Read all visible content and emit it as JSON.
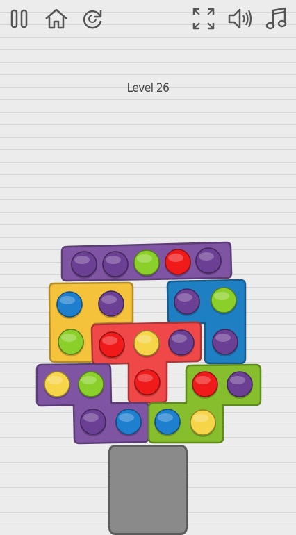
{
  "toolbar": {
    "buttons": [
      {
        "name": "pause-button",
        "icon": "pause-icon"
      },
      {
        "name": "home-button",
        "icon": "home-icon"
      },
      {
        "name": "restart-button",
        "icon": "restart-icon"
      },
      {
        "name": "fullscreen-button",
        "icon": "fullscreen-icon"
      },
      {
        "name": "sound-button",
        "icon": "speaker-icon"
      },
      {
        "name": "music-button",
        "icon": "music-note-icon"
      }
    ]
  },
  "level": {
    "label": "Level 26"
  },
  "colors": {
    "purple": "#7f54a3",
    "yellow": "#f5c33b",
    "blue": "#1f7fc3",
    "red": "#f04848",
    "green": "#86be2d",
    "stand": "#8a8a8a",
    "dot_purple": "#6b3f93",
    "dot_yellow": "#f6d548",
    "dot_blue": "#1f7fcf",
    "dot_red": "#f01a1a",
    "dot_green": "#8bd02a"
  },
  "pieces": [
    {
      "name": "piece-purple-bar",
      "color": "purple",
      "dots": [
        "purple",
        "purple",
        "green",
        "red",
        "purple"
      ]
    },
    {
      "name": "piece-yellow-l",
      "color": "yellow",
      "dots": [
        "blue",
        "purple",
        "green"
      ]
    },
    {
      "name": "piece-blue-l",
      "color": "blue",
      "dots": [
        "purple",
        "green",
        "purple"
      ]
    },
    {
      "name": "piece-red-t",
      "color": "red",
      "dots": [
        "red",
        "yellow",
        "purple",
        "red"
      ]
    },
    {
      "name": "piece-purple-s",
      "color": "purple",
      "dots": [
        "yellow",
        "green",
        "purple",
        "blue"
      ]
    },
    {
      "name": "piece-green-s",
      "color": "green",
      "dots": [
        "red",
        "purple",
        "blue",
        "yellow"
      ]
    }
  ]
}
